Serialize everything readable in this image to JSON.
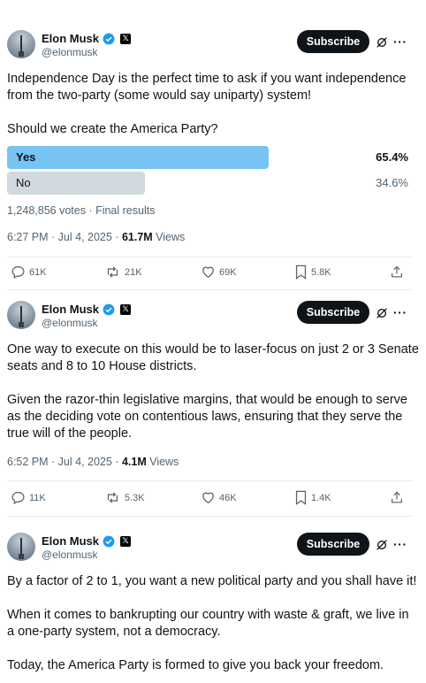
{
  "author": {
    "name": "Elon Musk",
    "handle": "@elonmusk",
    "subscribe_label": "Subscribe"
  },
  "colors": {
    "poll_winner": "#77c3f3",
    "poll_other": "#cfd9de",
    "subscribe_bg": "#0f1419",
    "verified": "#1d9bf0"
  },
  "tweets": [
    {
      "text": "Independence Day is the perfect time to ask if you want independence from the two-party (some would say uniparty) system!\n\nShould we create the America Party?",
      "poll": {
        "options": [
          {
            "label": "Yes",
            "percent": "65.4%",
            "fraction": 0.654
          },
          {
            "label": "No",
            "percent": "34.6%",
            "fraction": 0.346
          }
        ],
        "summary": "1,248,856 votes · Final results"
      },
      "time": "6:27 PM · Jul 4, 2025 · ",
      "views": "61.7M",
      "views_label": " Views",
      "stats": {
        "replies": "61K",
        "reposts": "21K",
        "likes": "69K",
        "bookmarks": "5.8K"
      }
    },
    {
      "text": "One way to execute on this would be to laser-focus on just 2 or 3 Senate seats and 8 to 10 House districts.\n\nGiven the razor-thin legislative margins, that would be enough to serve as the deciding vote on contentious laws, ensuring that they serve the true will of the people.",
      "time": "6:52 PM · Jul 4, 2025 · ",
      "views": "4.1M",
      "views_label": " Views",
      "stats": {
        "replies": "11K",
        "reposts": "5.3K",
        "likes": "46K",
        "bookmarks": "1.4K"
      }
    },
    {
      "text": "By a factor of 2 to 1, you want a new political party and you shall have it!\n\nWhen it comes to bankrupting our country with waste & graft, we live in a one-party system, not a democracy.\n\nToday, the America Party is formed to give you back your freedom."
    }
  ]
}
